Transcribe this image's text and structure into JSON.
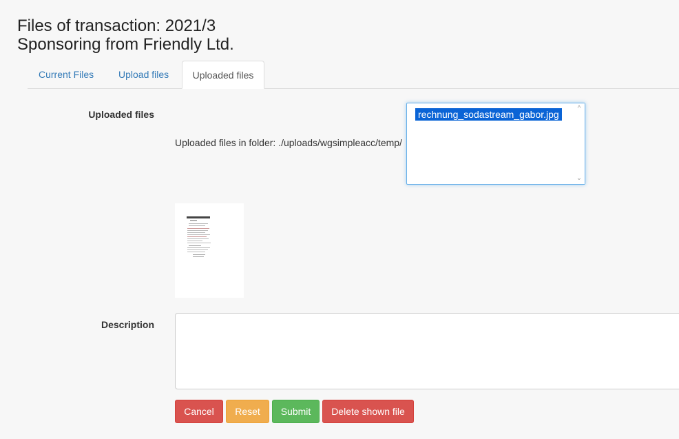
{
  "page": {
    "title_line1": "Files of transaction: 2021/3",
    "title_line2": "Sponsoring from Friendly Ltd."
  },
  "tabs": [
    {
      "label": "Current Files",
      "active": false
    },
    {
      "label": "Upload files",
      "active": false
    },
    {
      "label": "Uploaded files",
      "active": true
    }
  ],
  "uploaded": {
    "label": "Uploaded files",
    "folder_text": "Uploaded files in folder: ./uploads/wgsimpleacc/temp/",
    "files": [
      "rechnung_sodastream_gabor.jpg"
    ],
    "selected_file": "rechnung_sodastream_gabor.jpg"
  },
  "description": {
    "label": "Description",
    "value": ""
  },
  "buttons": {
    "cancel": "Cancel",
    "reset": "Reset",
    "submit": "Submit",
    "delete": "Delete shown file"
  },
  "colors": {
    "link": "#337ab7",
    "danger": "#d9534f",
    "warning": "#f0ad4e",
    "success": "#5cb85c",
    "selection": "#0a64d6"
  }
}
